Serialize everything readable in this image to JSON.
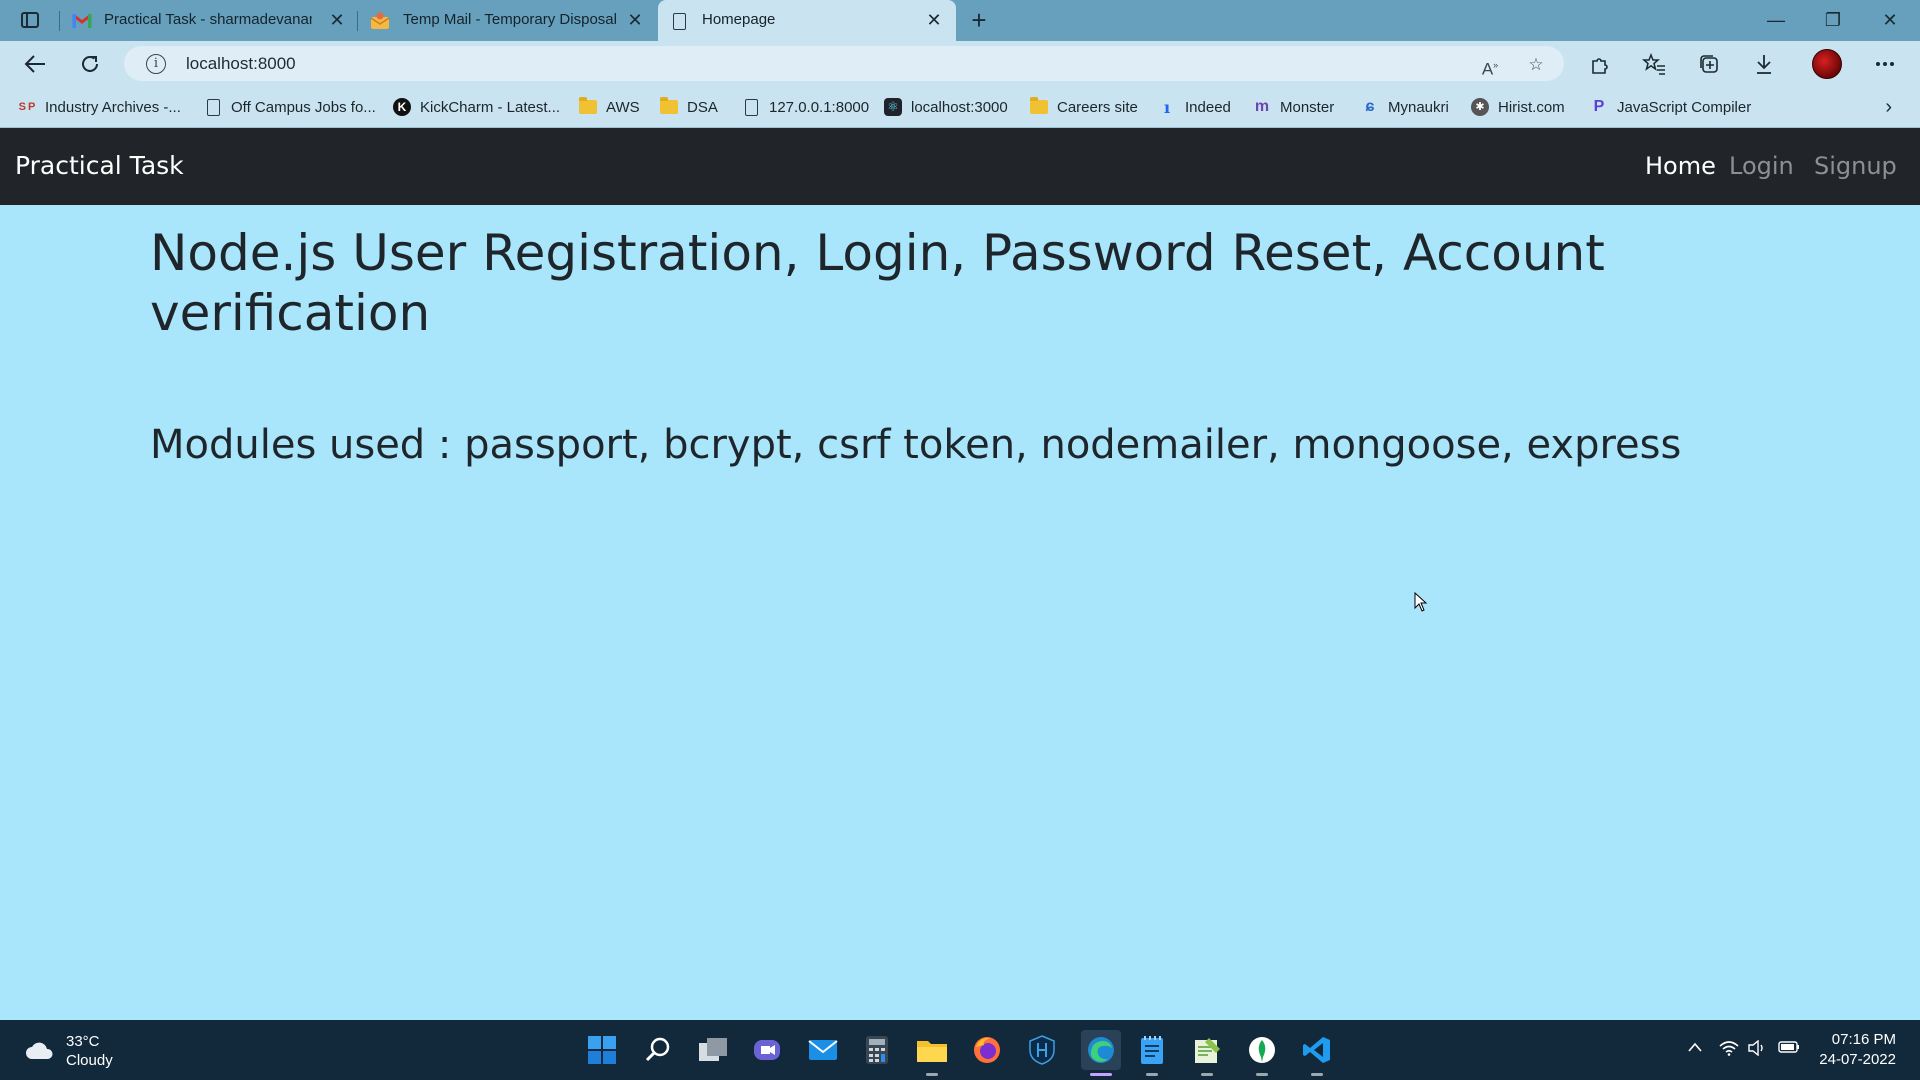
{
  "browser": {
    "tabs": [
      {
        "title": "Practical Task - sharmadevanand",
        "icon": "gmail-icon",
        "active": false
      },
      {
        "title": "Temp Mail - Temporary Disposab",
        "icon": "temp-mail-icon",
        "active": false
      },
      {
        "title": "Homepage",
        "icon": "page-icon",
        "active": true
      }
    ],
    "address": "localhost:8000",
    "bookmarks": [
      {
        "label": "Industry Archives -...",
        "icon": "sp-icon"
      },
      {
        "label": "Off Campus Jobs fo...",
        "icon": "page-icon"
      },
      {
        "label": "KickCharm - Latest...",
        "icon": "kickcharm-icon"
      },
      {
        "label": "AWS",
        "icon": "folder-icon"
      },
      {
        "label": "DSA",
        "icon": "folder-icon"
      },
      {
        "label": "127.0.0.1:8000",
        "icon": "page-icon"
      },
      {
        "label": "localhost:3000",
        "icon": "react-icon"
      },
      {
        "label": "Careers site",
        "icon": "folder-icon"
      },
      {
        "label": "Indeed",
        "icon": "indeed-icon"
      },
      {
        "label": "Monster",
        "icon": "monster-icon"
      },
      {
        "label": "Mynaukri",
        "icon": "naukri-icon"
      },
      {
        "label": "Hirist.com",
        "icon": "hirist-icon"
      },
      {
        "label": "JavaScript Compiler",
        "icon": "js-compiler-icon"
      }
    ]
  },
  "site": {
    "brand": "Practical Task",
    "nav": {
      "home": "Home",
      "login": "Login",
      "signup": "Signup"
    },
    "heading": "Node.js User Registration, Login, Password Reset, Account verification",
    "modules": "Modules used : passport, bcrypt, csrf token, nodemailer, mongoose, express"
  },
  "taskbar": {
    "weather": {
      "temp": "33°C",
      "condition": "Cloudy"
    },
    "time": "07:16 PM",
    "date": "24-07-2022"
  }
}
